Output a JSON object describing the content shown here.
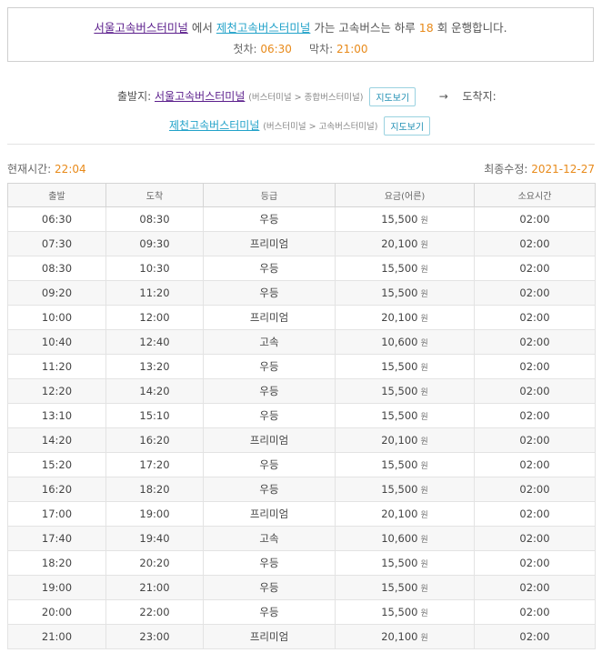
{
  "summary": {
    "from_terminal": "서울고속버스터미널",
    "mid_text_1": "에서",
    "to_terminal": "제천고속버스터미널",
    "mid_text_2": "가는 고속버스는 하루",
    "count": "18",
    "mid_text_3": "회 운행합니다.",
    "first_label": "첫차:",
    "first_time": "06:30",
    "last_label": "막차:",
    "last_time": "21:00"
  },
  "route": {
    "departure_label": "출발지:",
    "departure_name": "서울고속버스터미널",
    "departure_path": "(버스터미널 > 종합버스터미널)",
    "map_button": "지도보기",
    "arrow": "→",
    "arrival_label": "도착지:",
    "arrival_name": "제천고속버스터미널",
    "arrival_path": "(버스터미널 > 고속버스터미널)"
  },
  "status": {
    "current_time_label": "현재시간:",
    "current_time": "22:04",
    "updated_label": "최종수정:",
    "updated_date": "2021-12-27"
  },
  "table": {
    "headers": [
      "출발",
      "도착",
      "등급",
      "요금(어른)",
      "소요시간"
    ],
    "currency": "원",
    "rows": [
      {
        "dep": "06:30",
        "arr": "08:30",
        "grade": "우등",
        "fare": "15,500",
        "dur": "02:00"
      },
      {
        "dep": "07:30",
        "arr": "09:30",
        "grade": "프리미엄",
        "fare": "20,100",
        "dur": "02:00"
      },
      {
        "dep": "08:30",
        "arr": "10:30",
        "grade": "우등",
        "fare": "15,500",
        "dur": "02:00"
      },
      {
        "dep": "09:20",
        "arr": "11:20",
        "grade": "우등",
        "fare": "15,500",
        "dur": "02:00"
      },
      {
        "dep": "10:00",
        "arr": "12:00",
        "grade": "프리미엄",
        "fare": "20,100",
        "dur": "02:00"
      },
      {
        "dep": "10:40",
        "arr": "12:40",
        "grade": "고속",
        "fare": "10,600",
        "dur": "02:00"
      },
      {
        "dep": "11:20",
        "arr": "13:20",
        "grade": "우등",
        "fare": "15,500",
        "dur": "02:00"
      },
      {
        "dep": "12:20",
        "arr": "14:20",
        "grade": "우등",
        "fare": "15,500",
        "dur": "02:00"
      },
      {
        "dep": "13:10",
        "arr": "15:10",
        "grade": "우등",
        "fare": "15,500",
        "dur": "02:00"
      },
      {
        "dep": "14:20",
        "arr": "16:20",
        "grade": "프리미엄",
        "fare": "20,100",
        "dur": "02:00"
      },
      {
        "dep": "15:20",
        "arr": "17:20",
        "grade": "우등",
        "fare": "15,500",
        "dur": "02:00"
      },
      {
        "dep": "16:20",
        "arr": "18:20",
        "grade": "우등",
        "fare": "15,500",
        "dur": "02:00"
      },
      {
        "dep": "17:00",
        "arr": "19:00",
        "grade": "프리미엄",
        "fare": "20,100",
        "dur": "02:00"
      },
      {
        "dep": "17:40",
        "arr": "19:40",
        "grade": "고속",
        "fare": "10,600",
        "dur": "02:00"
      },
      {
        "dep": "18:20",
        "arr": "20:20",
        "grade": "우등",
        "fare": "15,500",
        "dur": "02:00"
      },
      {
        "dep": "19:00",
        "arr": "21:00",
        "grade": "우등",
        "fare": "15,500",
        "dur": "02:00"
      },
      {
        "dep": "20:00",
        "arr": "22:00",
        "grade": "우등",
        "fare": "15,500",
        "dur": "02:00"
      },
      {
        "dep": "21:00",
        "arr": "23:00",
        "grade": "프리미엄",
        "fare": "20,100",
        "dur": "02:00"
      }
    ]
  }
}
